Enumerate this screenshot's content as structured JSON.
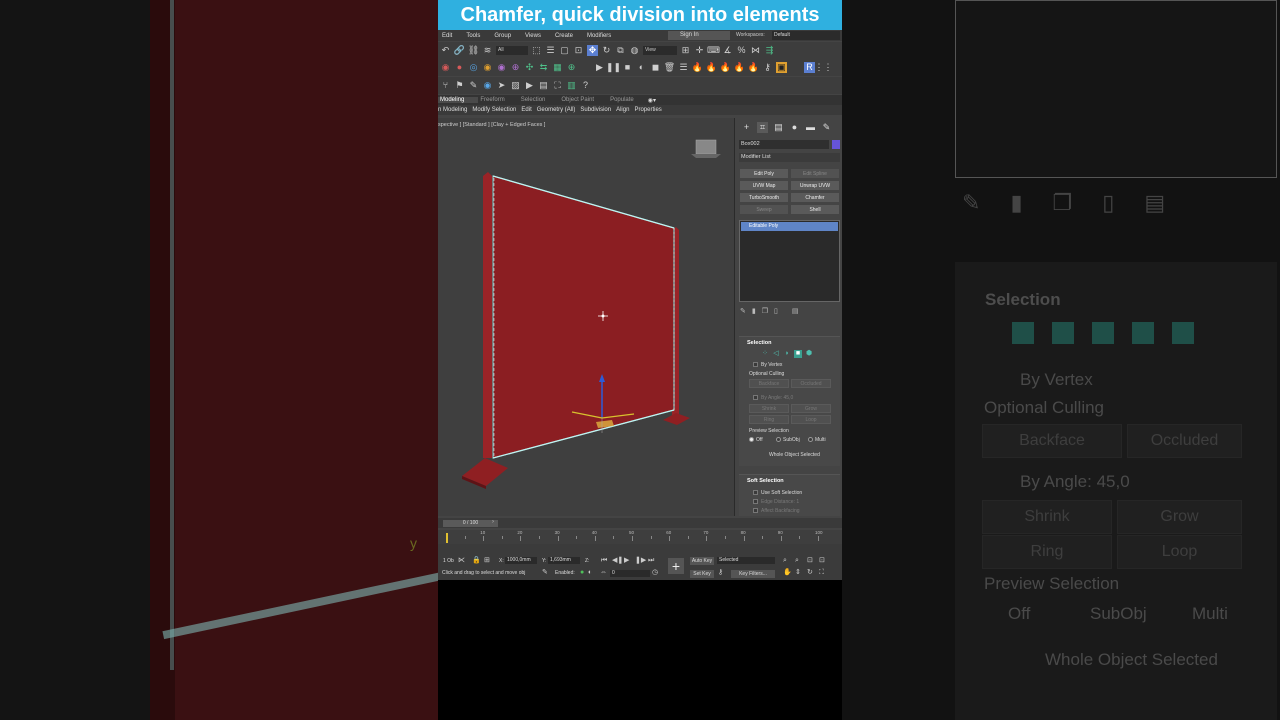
{
  "banner": {
    "title": "Chamfer, quick division into elements"
  },
  "menu": {
    "items": [
      "Edit",
      "Tools",
      "Group",
      "Views",
      "Create",
      "Modifiers"
    ],
    "sign_in": "Sign In",
    "workspaces_label": "Workspaces:",
    "workspaces_value": "Default"
  },
  "toolbar": {
    "selection_filter": "All",
    "view_dropdown": "View"
  },
  "ribbon": {
    "tabs": [
      "Modeling",
      "Freeform",
      "Selection",
      "Object Paint",
      "Populate"
    ],
    "active_tab": "Modeling",
    "subtabs": [
      "n Modeling",
      "Modify Selection",
      "Edit",
      "Geometry (All)",
      "Subdivision",
      "Align",
      "Properties"
    ]
  },
  "viewport": {
    "label": "spective ] [Standard ] [Clay + Edged Faces ]"
  },
  "command_panel": {
    "object_name": "Box002",
    "object_color": "#6654d8",
    "modifier_list": "Modifier List",
    "modifier_buttons": [
      {
        "label": "Edit Poly",
        "enabled": true
      },
      {
        "label": "Edit Spline",
        "enabled": false
      },
      {
        "label": "UVW Map",
        "enabled": true
      },
      {
        "label": "Unwrap UVW",
        "enabled": true
      },
      {
        "label": "TurboSmooth",
        "enabled": true
      },
      {
        "label": "Chamfer",
        "enabled": true
      },
      {
        "label": "Sweep",
        "enabled": false
      },
      {
        "label": "Shell",
        "enabled": true
      }
    ],
    "stack_item": "Editable Poly",
    "selection": {
      "title": "Selection",
      "by_vertex": "By Vertex",
      "optional_culling": "Optional Culling",
      "backface": "Backface",
      "occluded": "Occluded",
      "by_angle_label": "By Angle:",
      "by_angle_value": "45,0",
      "shrink": "Shrink",
      "grow": "Grow",
      "ring": "Ring",
      "loop": "Loop",
      "preview_selection": "Preview Selection",
      "preview_options": [
        "Off",
        "SubObj",
        "Multi"
      ],
      "preview_active": "Off",
      "status": "Whole Object Selected"
    },
    "soft_selection": {
      "title": "Soft Selection",
      "use_soft": "Use Soft Selection",
      "edge_distance": "Edge Distance:",
      "edge_distance_value": "1",
      "affect_backfacing": "Affect Backfacing"
    }
  },
  "timeline": {
    "frame_display": "0 / 100",
    "ticks": [
      10,
      20,
      30,
      40,
      50,
      60,
      70,
      80,
      90,
      100
    ],
    "start": 0,
    "end": 100
  },
  "status": {
    "selection_count": "1 Ob",
    "x_label": "X:",
    "x_value": "1000,0mm",
    "y_label": "Y:",
    "y_value": "1,693mm",
    "z_label": "Z:",
    "hint": "Click and drag to select and move obj",
    "enabled_label": "Enabled:",
    "frame_value": "0",
    "auto_key": "Auto Key",
    "set_key": "Set Key",
    "key_mode_value": "Selected",
    "key_filters": "Key Filters..."
  },
  "background_right": {
    "selection_title": "Selection",
    "by_vertex": "By Vertex",
    "optional_culling": "Optional Culling",
    "backface": "Backface",
    "occluded": "Occluded",
    "by_angle_label": "By Angle:",
    "by_angle_value": "45,0",
    "shrink": "Shrink",
    "grow": "Grow",
    "ring": "Ring",
    "loop": "Loop",
    "preview_selection": "Preview Selection",
    "preview_options": [
      "Off",
      "SubObj",
      "Multi"
    ],
    "status": "Whole Object Selected"
  },
  "background_left": {
    "axis_letter": "y"
  },
  "colors": {
    "banner": "#2fb0e0",
    "panel": "#8b1e22",
    "highlight_edge": "#7fe3e0",
    "stack_item": "#5f85c7"
  }
}
